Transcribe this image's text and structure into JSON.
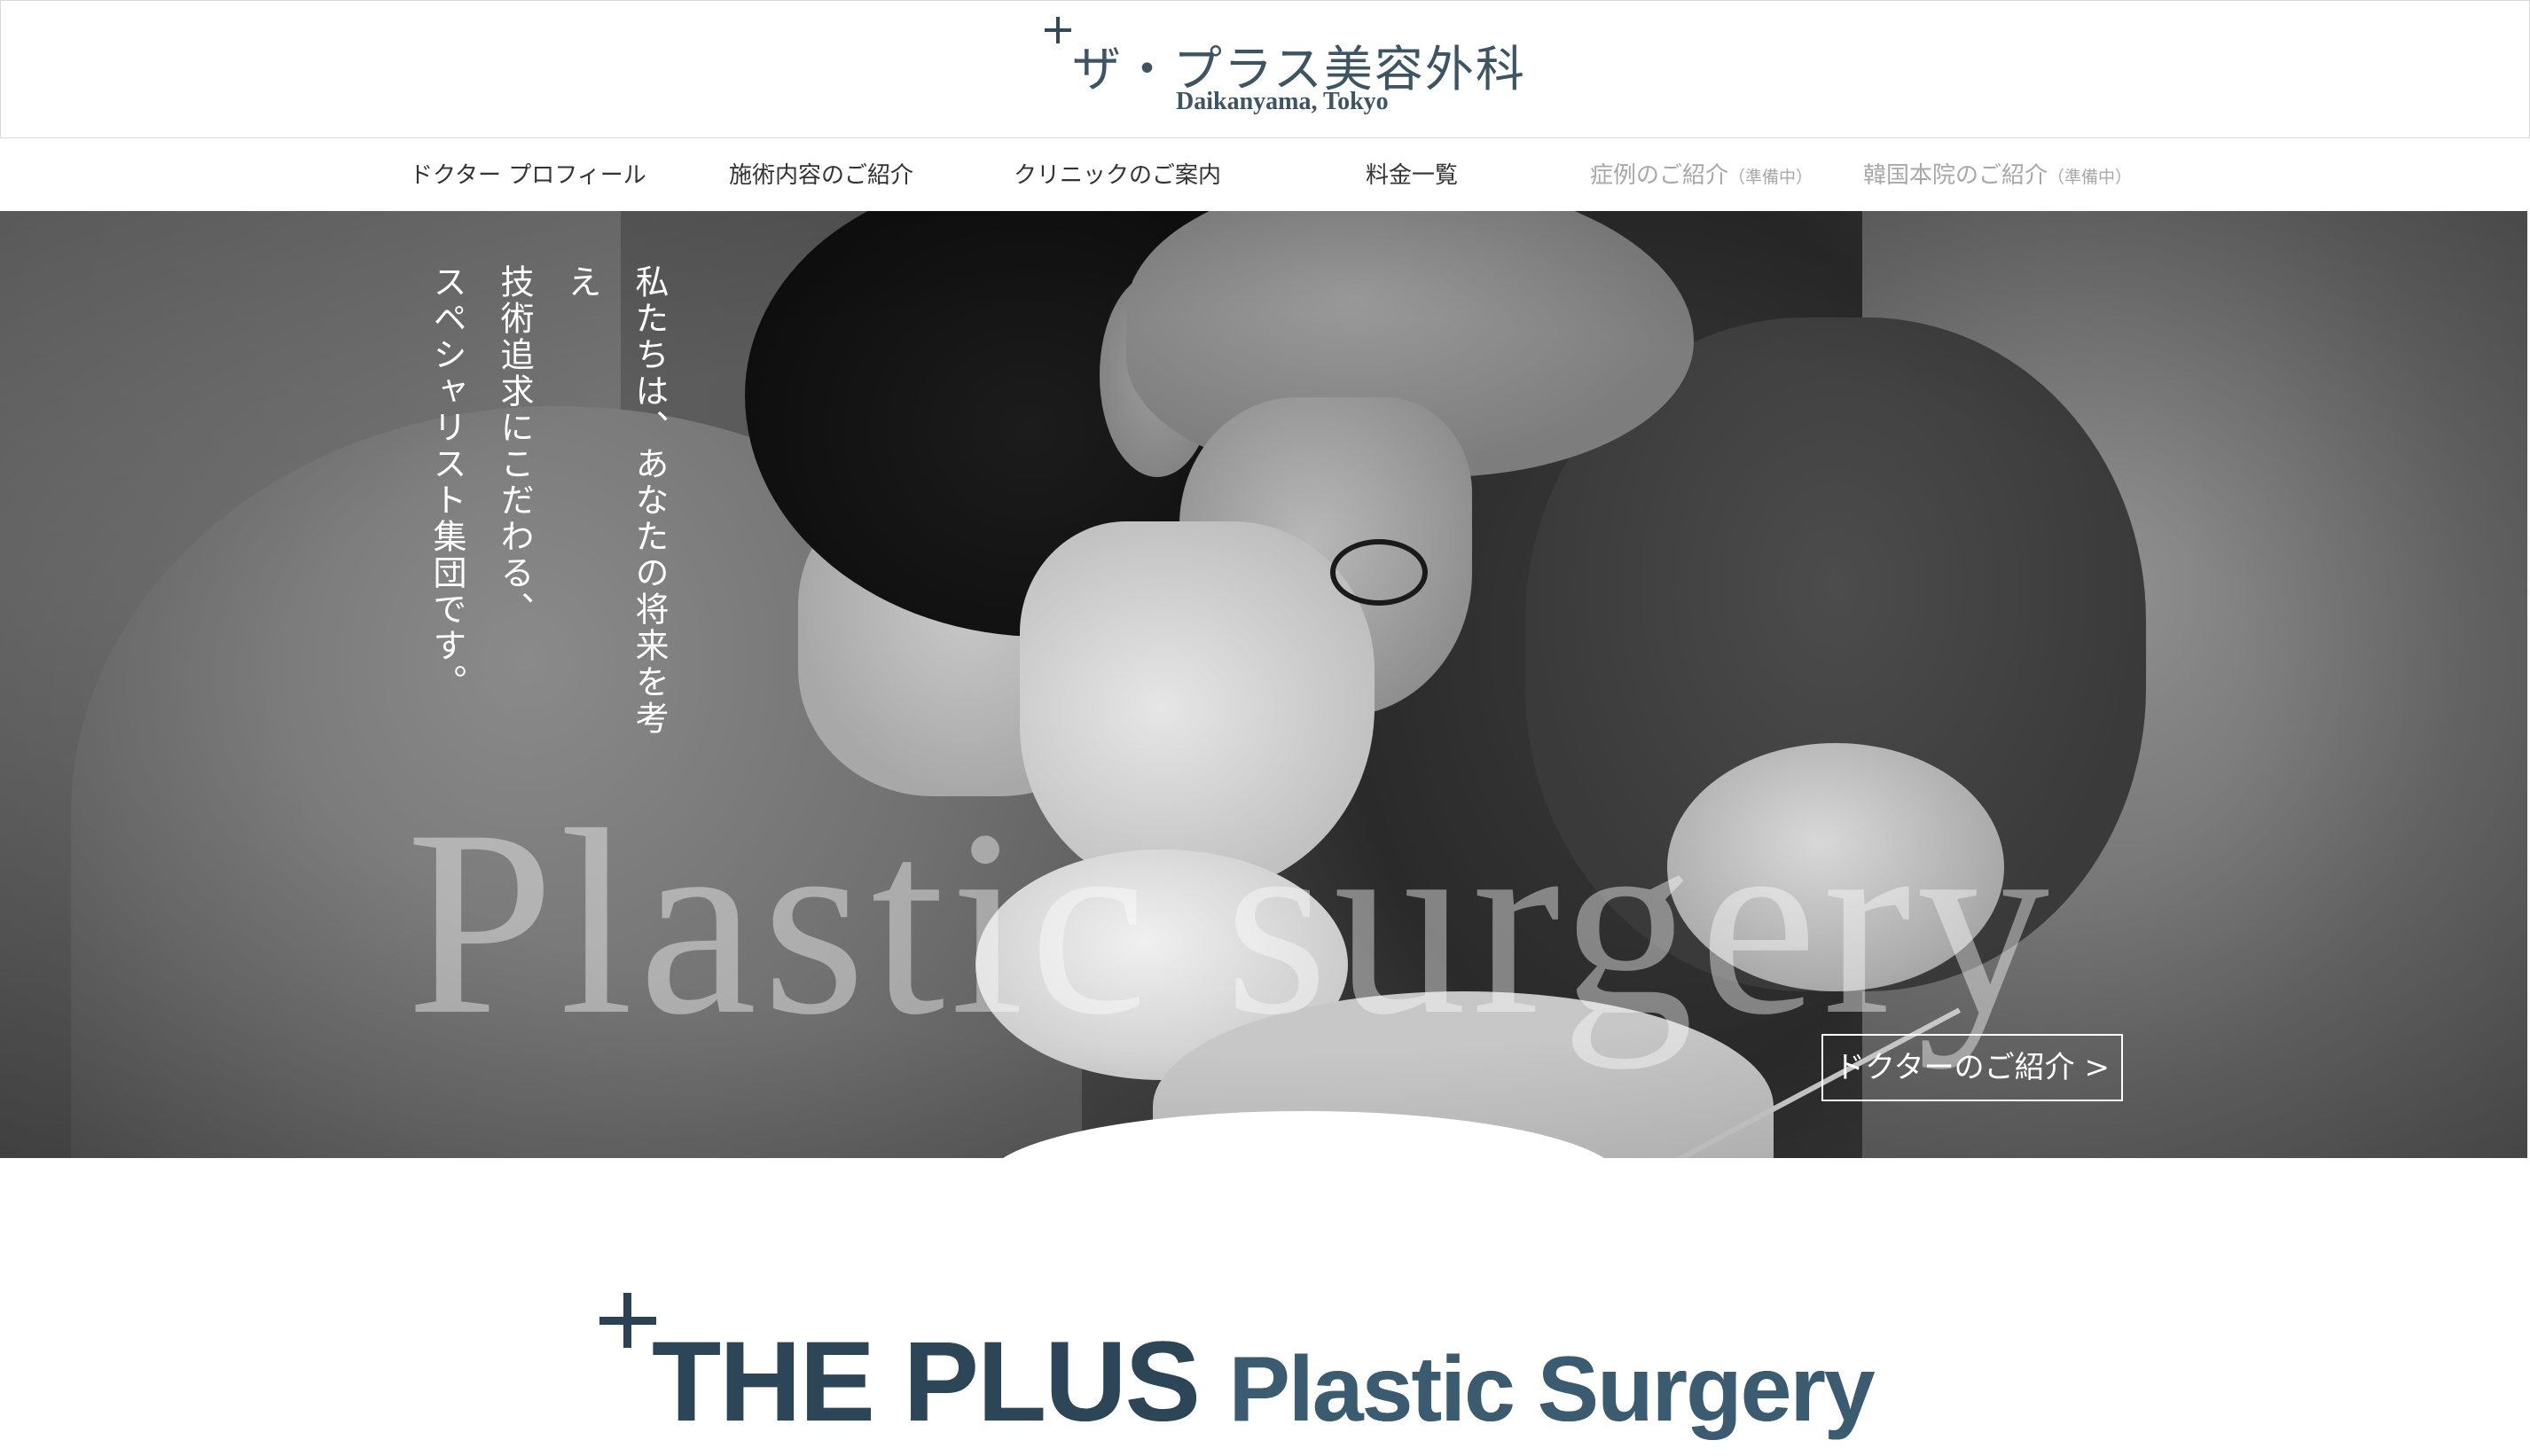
{
  "header": {
    "brand_jp": "ザ・プラス美容外科",
    "brand_en": "Daikanyama, Tokyo"
  },
  "nav": {
    "items": [
      {
        "label": "ドクター プロフィール",
        "note": "",
        "enabled": true
      },
      {
        "label": "施術内容のご紹介",
        "note": "",
        "enabled": true
      },
      {
        "label": "クリニックのご案内",
        "note": "",
        "enabled": true
      },
      {
        "label": "料金一覧",
        "note": "",
        "enabled": true
      },
      {
        "label": "症例のご紹介",
        "note": "（準備中）",
        "enabled": false
      },
      {
        "label": "韓国本院のご紹介",
        "note": "（準備中）",
        "enabled": false
      }
    ]
  },
  "hero": {
    "tagline": [
      "私たちは、あなたの将来を考え",
      "技術追求にこだわる、",
      "スペシャリスト集団です。"
    ],
    "watermark": "Plastic surgery",
    "cta_label": "ドクターのご紹介 >"
  },
  "logo_section": {
    "logo_part1": "THE PLUS",
    "logo_part2": "Plastic Surgery"
  },
  "colors": {
    "brand": "#3d5563",
    "nav_text": "#333333",
    "nav_disabled": "#a8a8a8",
    "logo": "#2c4557"
  }
}
